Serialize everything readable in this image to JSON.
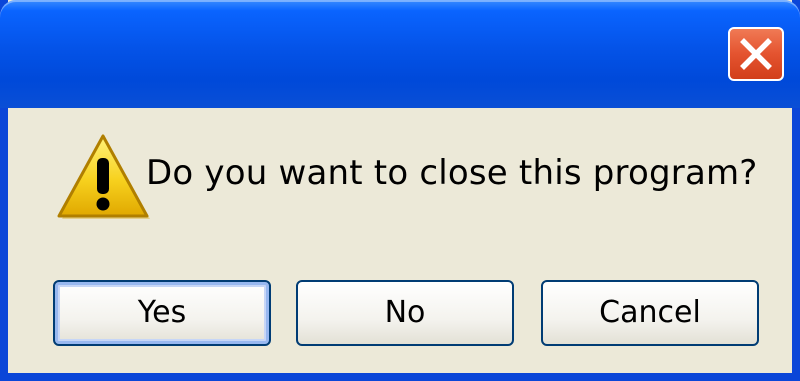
{
  "dialog": {
    "title": "",
    "message": "Do you want to close this program?",
    "icon": "warning-icon",
    "close_icon": "close-icon",
    "colors": {
      "titlebar": "#0453e8",
      "close_button": "#e4532f",
      "body": "#ece9d8",
      "button_border": "#003c74",
      "warning": "#f7d11e"
    }
  },
  "buttons": {
    "yes_label": "Yes",
    "no_label": "No",
    "cancel_label": "Cancel"
  }
}
